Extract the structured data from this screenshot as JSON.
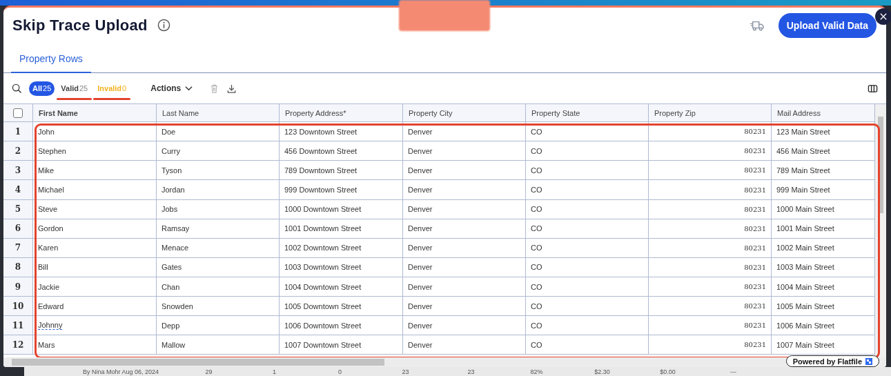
{
  "window": {
    "title": "Skip Trace Upload"
  },
  "header": {
    "upload_button": "Upload Valid Data"
  },
  "tabs": [
    {
      "label": "Property Rows",
      "selected": true
    }
  ],
  "filters": [
    {
      "kind": "all",
      "label": "All",
      "count": "25",
      "selected": true,
      "highlighted": false
    },
    {
      "kind": "valid",
      "label": "Valid",
      "count": "25",
      "selected": false,
      "highlighted": true
    },
    {
      "kind": "invalid",
      "label": "Invalid",
      "count": "0",
      "selected": false,
      "highlighted": true
    }
  ],
  "actions_menu": {
    "label": "Actions",
    "delete_disabled": true
  },
  "table": {
    "highlighted": true,
    "header_checked": false,
    "columns": [
      {
        "label": "First Name",
        "sorted": true
      },
      {
        "label": "Last Name",
        "sorted": false
      },
      {
        "label": "Property Address*",
        "sorted": false
      },
      {
        "label": "Property City",
        "sorted": false
      },
      {
        "label": "Property State",
        "sorted": false
      },
      {
        "label": "Property Zip",
        "sorted": false
      },
      {
        "label": "Mail Address",
        "sorted": false
      }
    ],
    "rows": [
      {
        "number": "1",
        "flagged": false,
        "cells": [
          "John",
          "Doe",
          "123 Downtown Street",
          "Denver",
          "CO",
          "80231",
          "123 Main Street"
        ]
      },
      {
        "number": "2",
        "flagged": false,
        "cells": [
          "Stephen",
          "Curry",
          "456 Downtown Street",
          "Denver",
          "CO",
          "80231",
          "456 Main Street"
        ]
      },
      {
        "number": "3",
        "flagged": false,
        "cells": [
          "Mike",
          "Tyson",
          "789 Downtown Street",
          "Denver",
          "CO",
          "80231",
          "789 Main Street"
        ]
      },
      {
        "number": "4",
        "flagged": false,
        "cells": [
          "Michael",
          "Jordan",
          "999 Downtown Street",
          "Denver",
          "CO",
          "80231",
          "999 Main Street"
        ]
      },
      {
        "number": "5",
        "flagged": false,
        "cells": [
          "Steve",
          "Jobs",
          "1000 Downtown Street",
          "Denver",
          "CO",
          "80231",
          "1000 Main Street"
        ]
      },
      {
        "number": "6",
        "flagged": false,
        "cells": [
          "Gordon",
          "Ramsay",
          "1001 Downtown Street",
          "Denver",
          "CO",
          "80231",
          "1001 Main Street"
        ]
      },
      {
        "number": "7",
        "flagged": false,
        "cells": [
          "Karen",
          "Menace",
          "1002 Downtown Street",
          "Denver",
          "CO",
          "80231",
          "1002 Main Street"
        ]
      },
      {
        "number": "8",
        "flagged": false,
        "cells": [
          "Bill",
          "Gates",
          "1003 Downtown Street",
          "Denver",
          "CO",
          "80231",
          "1003 Main Street"
        ]
      },
      {
        "number": "9",
        "flagged": false,
        "cells": [
          "Jackie",
          "Chan",
          "1004 Downtown Street",
          "Denver",
          "CO",
          "80231",
          "1004 Main Street"
        ]
      },
      {
        "number": "10",
        "flagged": false,
        "cells": [
          "Edward",
          "Snowden",
          "1005 Downtown Street",
          "Denver",
          "CO",
          "80231",
          "1005 Main Street"
        ]
      },
      {
        "number": "11",
        "flagged": true,
        "cells": [
          "Johnny",
          "Depp",
          "1006 Downtown Street",
          "Denver",
          "CO",
          "80231",
          "1006 Main Street"
        ]
      },
      {
        "number": "12",
        "flagged": false,
        "cells": [
          "Mars",
          "Mallow",
          "1007 Downtown Street",
          "Denver",
          "CO",
          "80231",
          "1007 Main Street"
        ]
      }
    ]
  },
  "badge": {
    "label": "Powered by Flatfile"
  },
  "background_row": {
    "author": "By Nina Mohr Aug 06, 2024",
    "cells": [
      "29",
      "1",
      "0",
      "23",
      "23",
      "82%",
      "$2.30",
      "$0.00"
    ],
    "trailing": "---"
  }
}
